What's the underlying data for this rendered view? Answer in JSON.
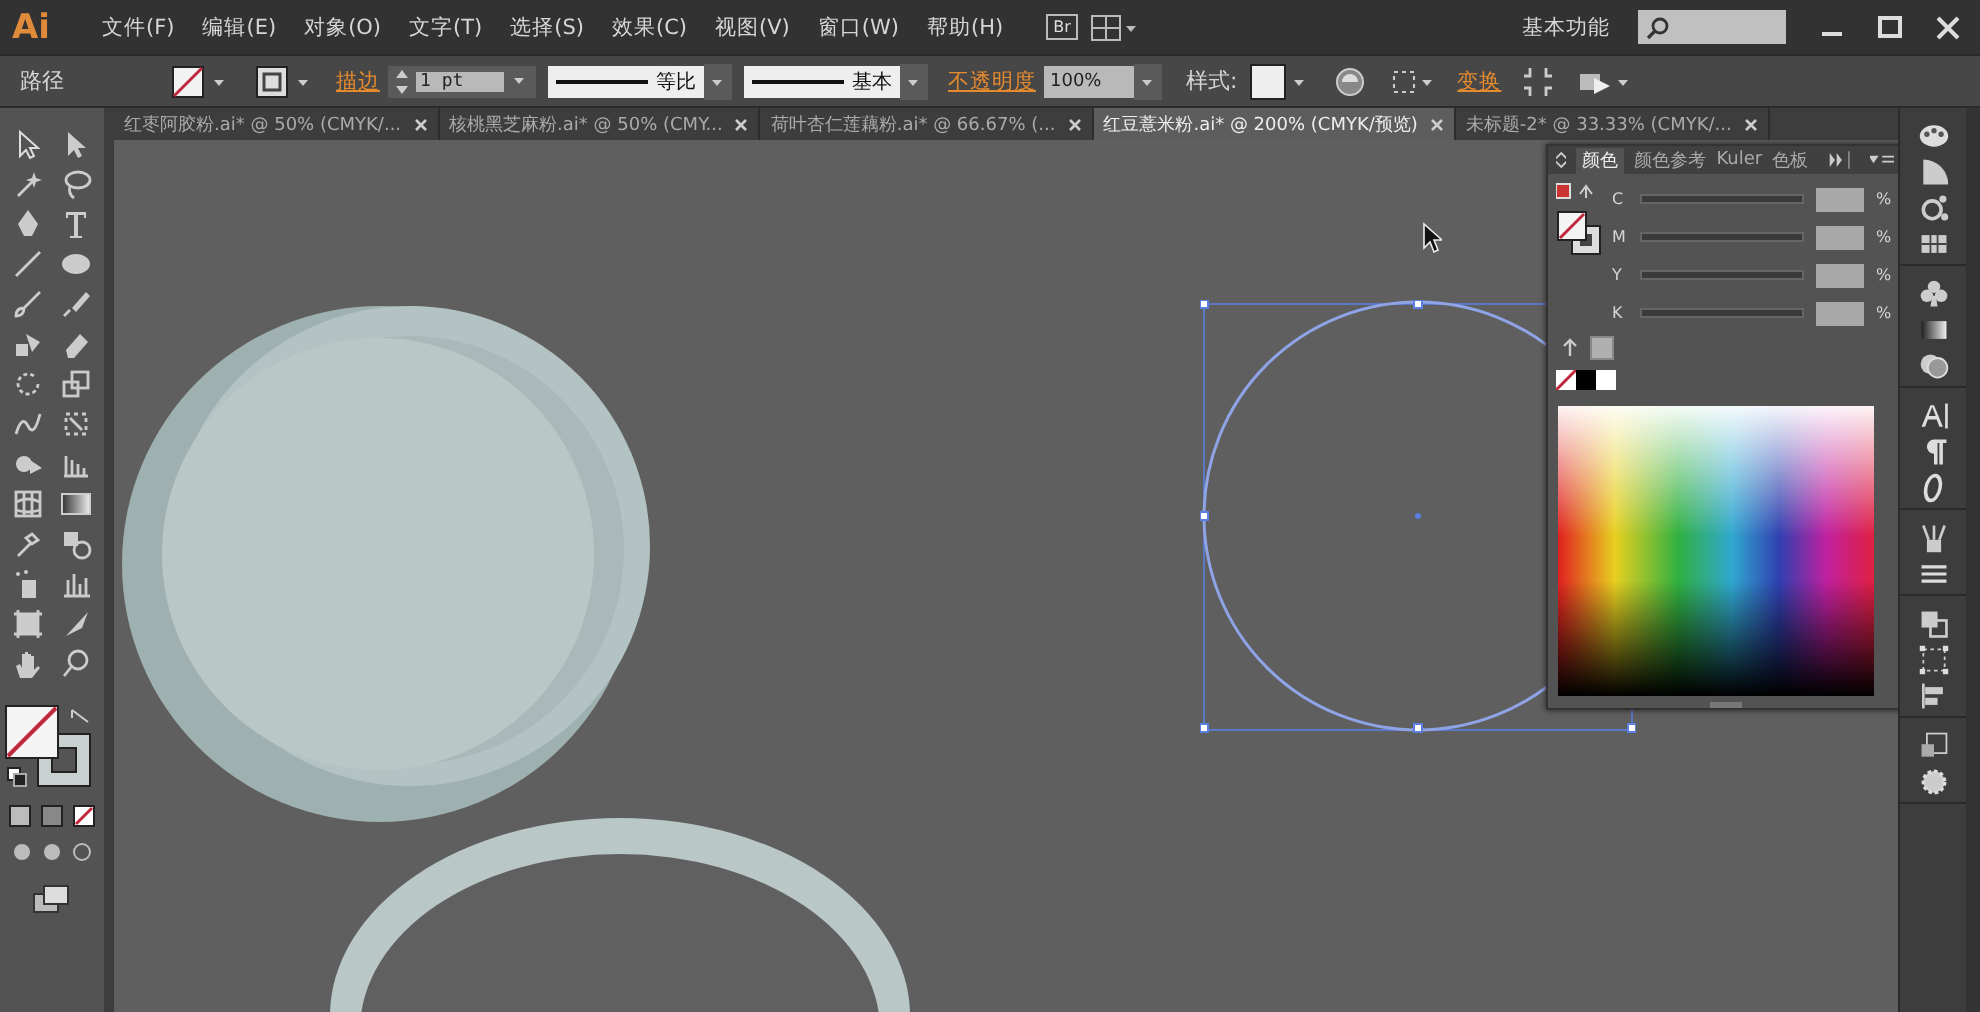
{
  "app": {
    "logo": "Ai",
    "menu": [
      "文件(F)",
      "编辑(E)",
      "对象(O)",
      "文字(T)",
      "选择(S)",
      "效果(C)",
      "视图(V)",
      "窗口(W)",
      "帮助(H)"
    ],
    "bridge": "Br",
    "workspace": "基本功能"
  },
  "control_bar": {
    "object": "路径",
    "stroke_label": "描边",
    "stroke_weight": "1 pt",
    "profile": "等比",
    "brush": "基本",
    "opacity_label": "不透明度",
    "opacity": "100%",
    "style_label": "样式:",
    "transform": "变换"
  },
  "doc_tabs": [
    {
      "label": "红枣阿胶粉.ai* @ 50% (CMYK/...",
      "selected": false
    },
    {
      "label": "核桃黑芝麻粉.ai* @ 50% (CMY...",
      "selected": false
    },
    {
      "label": "荷叶杏仁莲藕粉.ai* @ 66.67% (...",
      "selected": false
    },
    {
      "label": "红豆薏米粉.ai* @ 200% (CMYK/预览)",
      "selected": true
    },
    {
      "label": "未标题-2* @ 33.33% (CMYK/...",
      "selected": false
    }
  ],
  "color_panel": {
    "tabs": [
      {
        "label": "颜色",
        "selected": true
      },
      {
        "label": "颜色参考",
        "selected": false
      },
      {
        "label": "Kuler",
        "selected": false
      },
      {
        "label": "色板",
        "selected": false
      }
    ],
    "channels": [
      {
        "name": "C",
        "unit": "%"
      },
      {
        "name": "M",
        "unit": "%"
      },
      {
        "name": "Y",
        "unit": "%"
      },
      {
        "name": "K",
        "unit": "%"
      }
    ]
  }
}
